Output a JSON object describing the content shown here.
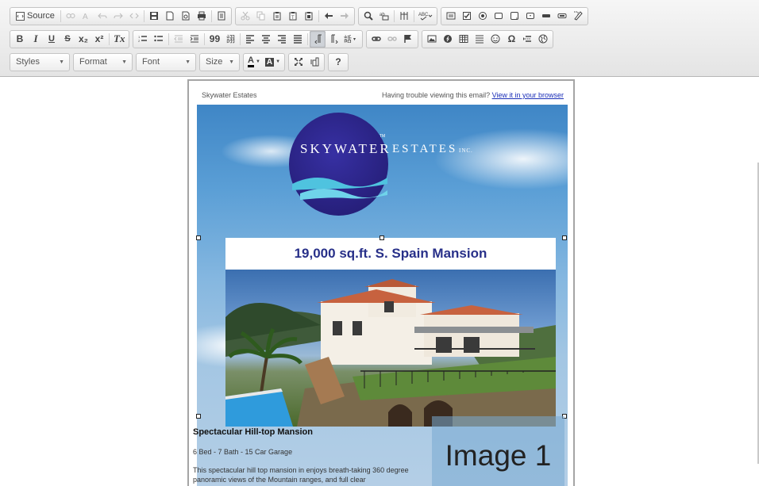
{
  "toolbar": {
    "row1": {
      "source_label": "Source",
      "icons": [
        "source-icon",
        "find-icon",
        "replace-icon",
        "undo-icon",
        "redo-icon",
        "code-icon",
        "save-icon",
        "new-page-icon",
        "preview-icon",
        "print-icon",
        "templates-icon",
        "cut-icon",
        "copy-icon",
        "paste-icon",
        "paste-text-icon",
        "paste-word-icon",
        "undo-arrow-icon",
        "redo-arrow-icon",
        "find-replace-icon",
        "select-all-icon",
        "scayt-icon",
        "spellcheck-icon",
        "form-icon",
        "checkbox-icon",
        "radio-icon",
        "textfield-icon",
        "textarea-icon",
        "select-field-icon",
        "button-icon",
        "image-button-icon",
        "hidden-field-icon"
      ]
    },
    "row2": {
      "bold": "B",
      "italic": "I",
      "underline": "U",
      "strike": "S",
      "subscript": "x₂",
      "superscript": "x²",
      "remove_format": "Tx",
      "blockquote": "99",
      "creatediv": "詡"
    },
    "row3": {
      "styles_label": "Styles",
      "format_label": "Format",
      "font_label": "Font",
      "size_label": "Size",
      "text_color_label": "A",
      "bg_color_label": "A",
      "help_label": "?"
    }
  },
  "email": {
    "company": "Skywater Estates",
    "trouble_text": "Having trouble viewing this email?",
    "view_link": "View it in your browser",
    "logo_word1": "SKYWATER",
    "logo_word2": "ESTATES",
    "logo_inc": "INC.",
    "logo_tm": "TM",
    "headline": "19,000 sq.ft. S. Spain Mansion",
    "desc_title": "Spectacular Hill-top Mansion",
    "desc_specs": "6 Bed - 7 Bath - 15 Car Garage",
    "desc_body": "This spectacular hill top mansion in enjoys breath-taking 360 degree panoramic views of the Mountain ranges, and full clear",
    "image_placeholder": "Image 1"
  },
  "colors": {
    "headline": "#283089",
    "logo_circle": "#2c2590",
    "link": "#1b2fb8",
    "toolbar_bg": "#ececec"
  }
}
